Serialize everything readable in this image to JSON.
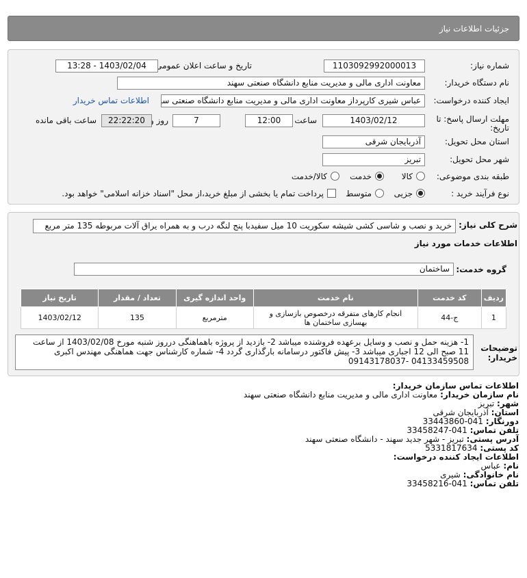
{
  "header": {
    "title": "جزئیات اطلاعات نیاز"
  },
  "info": {
    "need_number_label": "شماره نیاز:",
    "need_number": "1103092992000013",
    "announce_label": "تاریخ و ساعت اعلان عمومی:",
    "announce_value": "1403/02/04 - 13:28",
    "buyer_org_label": "نام دستگاه خریدار:",
    "buyer_org": "معاونت اداری  مالی و مدیریت منابع دانشگاه صنعتی سهند",
    "creator_label": "ایجاد کننده درخواست:",
    "creator": "عباس شیری کارپرداز معاونت اداری  مالی و مدیریت منابع دانشگاه صنعتی سهند",
    "contact_link": "اطلاعات تماس خریدار",
    "deadline_label_1": "مهلت ارسال پاسخ: تا",
    "deadline_label_2": "تاریخ:",
    "deadline_date": "1403/02/12",
    "time_label": "ساعت",
    "deadline_time": "12:00",
    "days_value": "7",
    "days_label": "روز و",
    "remaining_time": "22:22:20",
    "remaining_label": "ساعت باقی مانده",
    "province_label": "استان محل تحویل:",
    "province": "آذربایجان شرقی",
    "city_label": "شهر محل تحویل:",
    "city": "تبریز",
    "category_label": "طبقه بندی موضوعی:",
    "category_options": [
      "کالا",
      "خدمت",
      "کالا/خدمت"
    ],
    "category_selected": "خدمت",
    "process_label": "نوع فرآیند خرید :",
    "process_options": [
      "جزیی",
      "متوسط"
    ],
    "process_selected": "جزیی",
    "treasury_note": "پرداخت تمام یا بخشی از مبلغ خرید،از محل \"اسناد خزانه اسلامی\" خواهد بود."
  },
  "details": {
    "summary_label": "شرح کلی نیاز:",
    "summary": "خرید و نصب و شاسی کشی شیشه سکوریت 10 میل سفیدبا پنج لنگه درب و به همراه یراق آلات مربوطه 135 متر مربع",
    "services_heading": "اطلاعات خدمات مورد نیاز",
    "service_group_label": "گروه خدمت:",
    "service_group": "ساختمان",
    "table": {
      "headers": [
        "ردیف",
        "کد خدمت",
        "نام خدمت",
        "واحد اندازه گیری",
        "تعداد / مقدار",
        "تاریخ نیاز"
      ],
      "rows": [
        [
          "1",
          "ج-44",
          "انجام کارهای متفرقه درخصوص بازسازی و بهسازی ساختمان ها",
          "مترمربع",
          "135",
          "1403/02/12"
        ]
      ]
    },
    "notes_label": "توضیحات خریدار:",
    "notes": "1- هزینه حمل و نصب و وسایل برعهده فروشنده میباشد 2- بازدید از پروژه باهماهنگی درروز شنبه مورخ 1403/02/08 از ساعت 11 صبح الی 12 اجباری میباشد 3- پیش فاکتور درسامانه بارگذاری گردد 4- شماره کارشناس جهت هماهنگی مهندس اکبری 04133459508 -09143178037"
  },
  "contact": {
    "heading": "اطلاعات تماس سازمان خریدار:",
    "org_label": "نام سازمان خریدار:",
    "org": "معاونت اداری مالی و مدیریت منابع دانشگاه صنعتی سهند",
    "city_label": "شهر:",
    "city": "تبریز",
    "province_label": "استان:",
    "province": "آذربایجان شرقی",
    "fax_label": "دورنگار:",
    "fax": "041-33443860",
    "phone_label": "تلفن تماس:",
    "phone": "041-33458247",
    "address_label": "آدرس پستی:",
    "address": "تبریز - شهر جدید سهند - دانشگاه صنعتی سهند",
    "postal_label": "کد پستی:",
    "postal": "5331817634",
    "creator_heading": "اطلاعات ایجاد کننده درخواست:",
    "name_label": "نام:",
    "name": "عباس",
    "family_label": "نام خانوادگی:",
    "family": "شیری",
    "creator_phone_label": "تلفن تماس:",
    "creator_phone": "041-33458216"
  }
}
